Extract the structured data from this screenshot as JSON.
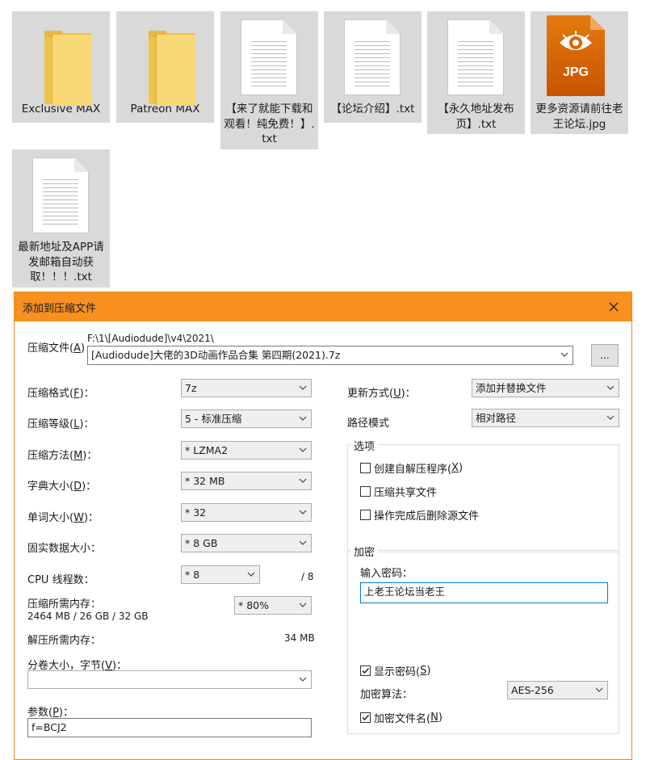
{
  "files": [
    {
      "name": "Exclusive MAX",
      "type": "folder"
    },
    {
      "name": "Patreon MAX",
      "type": "folder"
    },
    {
      "name": "【来了就能下载和观看！纯免费！】.txt",
      "type": "text"
    },
    {
      "name": "【论坛介绍】.txt",
      "type": "text"
    },
    {
      "name": "【永久地址发布页】.txt",
      "type": "text"
    },
    {
      "name": "更多资源请前往老王论坛.jpg",
      "type": "image",
      "badge": "JPG"
    },
    {
      "name": "最新地址及APP请发邮箱自动获取！！！.txt",
      "type": "text"
    }
  ],
  "dialog": {
    "title": "添加到压缩文件",
    "archive": {
      "label": "压缩文件(",
      "accel": "A",
      "label_end": ")",
      "path": "F:\\1\\[Audiodude]\\v4\\2021\\",
      "filename": "[Audiodude]大佬的3D动画作品合集 第四期(2021).7z",
      "browse": "..."
    },
    "left": {
      "format": {
        "label": "压缩格式(",
        "accel": "F",
        "label_end": ")：",
        "value": "7z"
      },
      "level": {
        "label": "压缩等级(",
        "accel": "L",
        "label_end": ")：",
        "value": "5 - 标准压缩"
      },
      "method": {
        "label": "压缩方法(",
        "accel": "M",
        "label_end": ")：",
        "value": "* LZMA2"
      },
      "dict": {
        "label": "字典大小(",
        "accel": "D",
        "label_end": ")：",
        "value": "* 32 MB"
      },
      "word": {
        "label": "单词大小(",
        "accel": "W",
        "label_end": ")：",
        "value": "* 32"
      },
      "solid": {
        "label": "固实数据大小：",
        "value": "* 8 GB"
      },
      "threads": {
        "label": "CPU 线程数：",
        "value": "* 8",
        "max": "/ 8"
      },
      "mem_compress": {
        "label": "压缩所需内存：",
        "detail": "2464 MB / 26 GB / 32 GB",
        "value": "* 80%"
      },
      "mem_decompress": {
        "label": "解压所需内存：",
        "value": "34 MB"
      },
      "volume": {
        "label": "分卷大小，字节(",
        "accel": "V",
        "label_end": ")：",
        "value": ""
      },
      "params": {
        "label": "参数(",
        "accel": "P",
        "label_end": ")：",
        "value": "f=BCJ2"
      }
    },
    "right": {
      "update": {
        "label": "更新方式(",
        "accel": "U",
        "label_end": ")：",
        "value": "添加并替换文件"
      },
      "pathmode": {
        "label": "路径模式",
        "value": "相对路径"
      },
      "options": {
        "title": "选项",
        "sfx": {
          "label": "创建自解压程序(",
          "accel": "X",
          "label_end": ")",
          "checked": false
        },
        "shared": {
          "label": "压缩共享文件",
          "checked": false
        },
        "delete": {
          "label": "操作完成后删除源文件",
          "checked": false
        }
      },
      "encryption": {
        "title": "加密",
        "password_label": "输入密码：",
        "password": "上老王论坛当老王",
        "show": {
          "label": "显示密码(",
          "accel": "S",
          "label_end": ")",
          "checked": true
        },
        "method_label": "加密算法：",
        "method": "AES-256",
        "encrypt_names": {
          "label": "加密文件名(",
          "accel": "N",
          "label_end": ")",
          "checked": true
        }
      }
    }
  },
  "colors": {
    "accent": "#f7901e",
    "folder": "#f8d775",
    "jpg": "#d96400"
  }
}
